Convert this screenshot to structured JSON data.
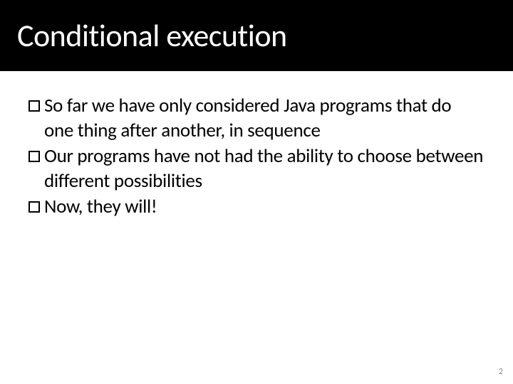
{
  "title": "Conditional execution",
  "bullets": [
    {
      "pre": "So far we have only considered ",
      "code": "Java",
      "post": " programs that do one thing after another, in sequence"
    },
    {
      "pre": "Our programs have not had the ability to choose between different possibilities",
      "code": "",
      "post": ""
    },
    {
      "pre": "Now, they will!",
      "code": "",
      "post": ""
    }
  ],
  "page_number": "2"
}
